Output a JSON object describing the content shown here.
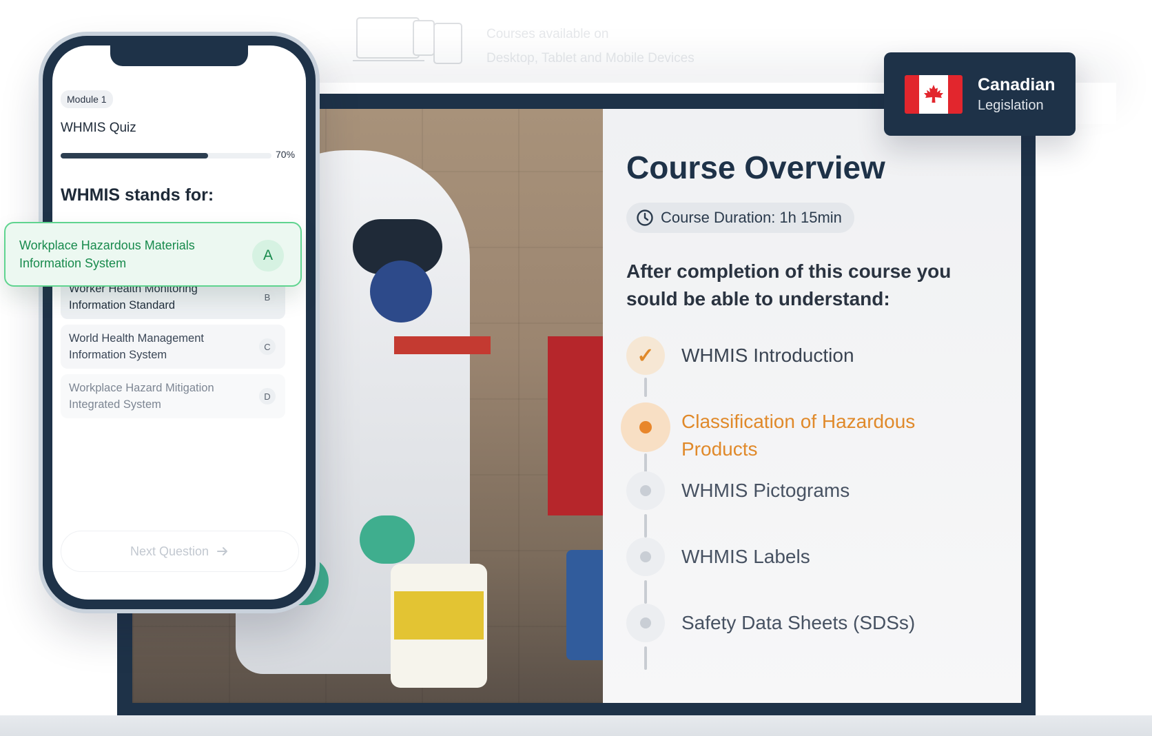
{
  "header": {
    "line1": "Courses available on",
    "line2": "Desktop, Tablet and Mobile Devices",
    "icon": "devices-icon"
  },
  "badge": {
    "title": "Canadian",
    "subtitle": "Legislation",
    "icon": "canada-flag-icon",
    "colors": {
      "bg": "#1e3248",
      "flag_red": "#e2262d"
    }
  },
  "overview": {
    "title": "Course Overview",
    "duration": "Course Duration: 1h 15min",
    "intro": "After completion of this course you sould be able to understand:",
    "topics": [
      {
        "label": "WHMIS Introduction",
        "status": "done"
      },
      {
        "label": "Classification of Hazardous Products",
        "status": "active"
      },
      {
        "label": "WHMIS Pictograms",
        "status": "pending"
      },
      {
        "label": "WHMIS Labels",
        "status": "pending"
      },
      {
        "label": "Safety Data Sheets (SDSs)",
        "status": "pending"
      }
    ],
    "colors": {
      "accent": "#e0892a",
      "title": "#1e3248"
    }
  },
  "phone": {
    "module": "Module 1",
    "quiz_title": "WHMIS Quiz",
    "progress": {
      "value": 0.7,
      "label": "70%"
    },
    "question": "WHMIS stands for:",
    "options": [
      {
        "text": "Workplace Hazardous Materials Information System",
        "letter": "A",
        "selected": true
      },
      {
        "text": "Worker Health Monitoring Information Standard",
        "letter": "B"
      },
      {
        "text": "World Health Management Information System",
        "letter": "C"
      },
      {
        "text": "Workplace Hazard Mitigation Integrated System",
        "letter": "D"
      }
    ],
    "next_button": "Next Question",
    "colors": {
      "correct": "#178a4c",
      "correct_border": "#5fd48f"
    }
  }
}
